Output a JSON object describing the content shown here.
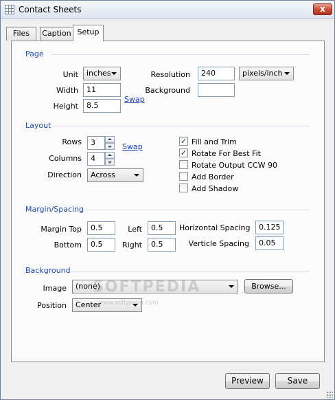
{
  "window": {
    "title": "Contact Sheets",
    "close_glyph": "x"
  },
  "tabs": [
    {
      "label": "Files"
    },
    {
      "label": "Caption"
    },
    {
      "label": "Setup",
      "active": true
    }
  ],
  "page": {
    "title": "Page",
    "unit_label": "Unit",
    "unit_value": "inches",
    "width_label": "Width",
    "width_value": "11",
    "height_label": "Height",
    "height_value": "8.5",
    "swap_label": "Swap",
    "resolution_label": "Resolution",
    "resolution_value": "240",
    "resolution_unit": "pixels/inch",
    "background_label": "Background",
    "background_color": "#ffffff"
  },
  "layout": {
    "title": "Layout",
    "rows_label": "Rows",
    "rows_value": "3",
    "columns_label": "Columns",
    "columns_value": "4",
    "swap_label": "Swap",
    "direction_label": "Direction",
    "direction_value": "Across",
    "options": [
      {
        "label": "Fill and Trim",
        "checked": true
      },
      {
        "label": "Rotate For Best Fit",
        "checked": true
      },
      {
        "label": "Rotate Output CCW 90",
        "checked": false
      },
      {
        "label": "Add Border",
        "checked": false
      },
      {
        "label": "Add Shadow",
        "checked": false
      }
    ]
  },
  "margin": {
    "title": "Margin/Spacing",
    "top_label": "Margin Top",
    "top_value": "0.5",
    "left_label": "Left",
    "left_value": "0.5",
    "bottom_label": "Bottom",
    "bottom_value": "0.5",
    "right_label": "Right",
    "right_value": "0.5",
    "hspacing_label": "Horizontal Spacing",
    "hspacing_value": "0.125",
    "vspacing_label": "Verticle Spacing",
    "vspacing_value": "0.05"
  },
  "background": {
    "title": "Background",
    "image_label": "Image",
    "image_value": "(none)",
    "browse_label": "Browse...",
    "position_label": "Position",
    "position_value": "Center"
  },
  "watermark": {
    "text": "SOFTPEDIA",
    "sub": "www.softpedia.com"
  },
  "footer": {
    "preview_label": "Preview",
    "save_label": "Save"
  },
  "colors": {
    "section_title": "#1f4aa8",
    "link": "#1a3fbf",
    "close_button": "#c64b31"
  },
  "icons": {
    "app": "contact-sheet-grid-icon",
    "close": "close-icon",
    "check": "check-icon"
  }
}
